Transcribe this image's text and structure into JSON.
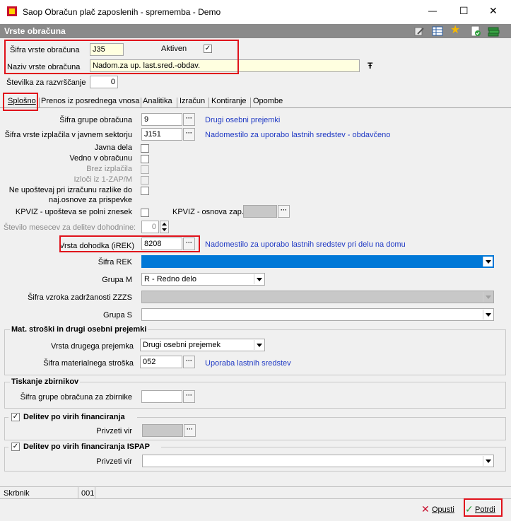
{
  "window": {
    "title": "Saop Obračun plač zaposlenih - sprememba - Demo",
    "minimize": "—",
    "maximize": "☐",
    "close": "✕"
  },
  "header": {
    "title": "Vrste obračuna"
  },
  "top": {
    "sifra_label": "Šifra vrste obračuna",
    "sifra_value": "J35",
    "aktiven_label": "Aktiven",
    "aktiven_checked": true,
    "naziv_label": "Naziv vrste obračuna",
    "naziv_value": "Nadom.za up. last.sred.-obdav.",
    "stevilka_label": "Številka  za razvrščanje",
    "stevilka_value": "0"
  },
  "tabs": [
    "Splošno",
    "Prenos iz posrednega vnosa",
    "Analitika",
    "Izračun",
    "Kontiranje",
    "Opombe"
  ],
  "form": {
    "sifra_grupe_label": "Šifra grupe obračuna",
    "sifra_grupe_value": "9",
    "sifra_grupe_desc": "Drugi osebni prejemki",
    "sifra_izplacila_label": "Šifra vrste izplačila v javnem sektorju",
    "sifra_izplacila_value": "J151",
    "sifra_izplacila_desc": "Nadomestilo za uporabo lastnih sredstev - obdavčeno",
    "javna_dela_label": "Javna dela",
    "vedno_label": "Vedno v obračunu",
    "brez_izplacila_label": "Brez izplačila",
    "izloci_label": "Izloči iz 1-ZAP/M",
    "ne_upostevaj_line1": "Ne upoštevaj pri izračunu razlike do",
    "ne_upostevaj_line2": "naj.osnove za prispevke",
    "kpviz_polni_label": "KPVIZ - upošteva se polni znesek",
    "kpviz_osnova_label": "KPVIZ - osnova zap.",
    "stevilo_mesecev_label": "Število mesecev za delitev dohodnine:",
    "stevilo_mesecev_value": "0",
    "vrsta_dohodka_label": "Vrsta dohodka (iREK)",
    "vrsta_dohodka_value": "8208",
    "vrsta_dohodka_desc": "Nadomestilo za uporabo lastnih sredstev pri delu na domu",
    "sifra_rek_label": "Šifra REK",
    "grupa_m_label": "Grupa M",
    "grupa_m_value": "R - Redno delo",
    "sifra_vzroka_label": "Šifra vzroka zadržanosti ZZZS",
    "grupa_s_label": "Grupa S"
  },
  "mat_stroski": {
    "title": "Mat. stroški in drugi osebni prejemki",
    "vrsta_label": "Vrsta drugega prejemka",
    "vrsta_value": "Drugi osebni prejemek",
    "sifra_label": "Šifra materialnega stroška",
    "sifra_value": "052",
    "sifra_desc": "Uporaba lastnih sredstev"
  },
  "tiskanje": {
    "title": "Tiskanje zbirnikov",
    "sifra_label": "Šifra grupe obračuna za zbirnike"
  },
  "delitev": {
    "title": "Delitev po virih financiranja",
    "privzeti_label": "Privzeti vir"
  },
  "delitev_ispap": {
    "title": "Delitev po virih financiranja ISPAP",
    "privzeti_label": "Privzeti vir"
  },
  "status": {
    "skrbnik_label": "Skrbnik",
    "skrbnik_value": "001"
  },
  "buttons": {
    "opusti": "Opusti",
    "potrdi": "Potrdi"
  },
  "colors": {
    "accent_blue": "#0078d7",
    "highlight_red": "#e0121b",
    "description_blue": "#1f39c4"
  }
}
